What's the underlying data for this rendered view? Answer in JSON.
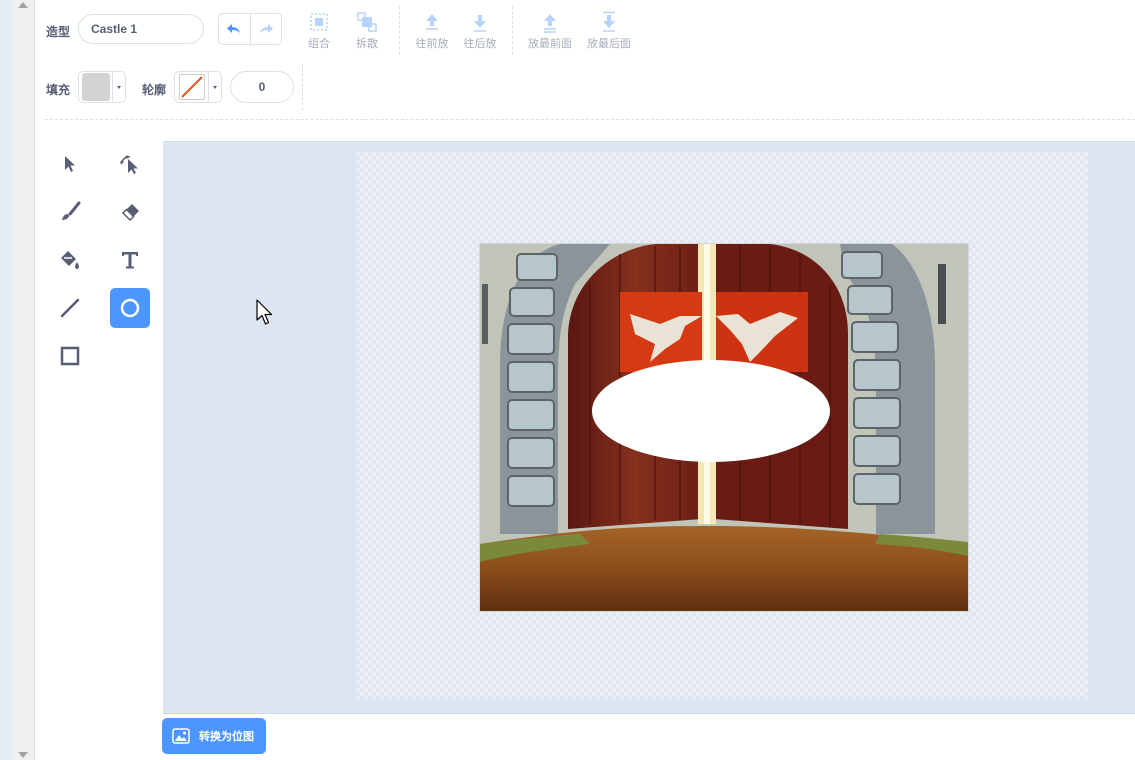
{
  "toolbar": {
    "costume_label": "造型",
    "costume_name": "Castle 1",
    "actions": {
      "group": "组合",
      "ungroup": "拆散",
      "forward": "往前放",
      "backward": "往后放",
      "front": "放最前面",
      "back": "放最后面"
    }
  },
  "properties": {
    "fill_label": "填充",
    "fill_color": "#d3d3d3",
    "outline_label": "轮廓",
    "outline_color": "#e05a1b",
    "outline_width": "0"
  },
  "tools": {
    "selected": "ellipse",
    "list": [
      "select",
      "reshape",
      "brush",
      "eraser",
      "fill",
      "text",
      "line",
      "ellipse",
      "rectangle"
    ]
  },
  "convert_bitmap_label": "转换为位图",
  "colors": {
    "accent": "#4c97ff",
    "text": "#575e75",
    "canvas_bg": "#dde5f3"
  }
}
